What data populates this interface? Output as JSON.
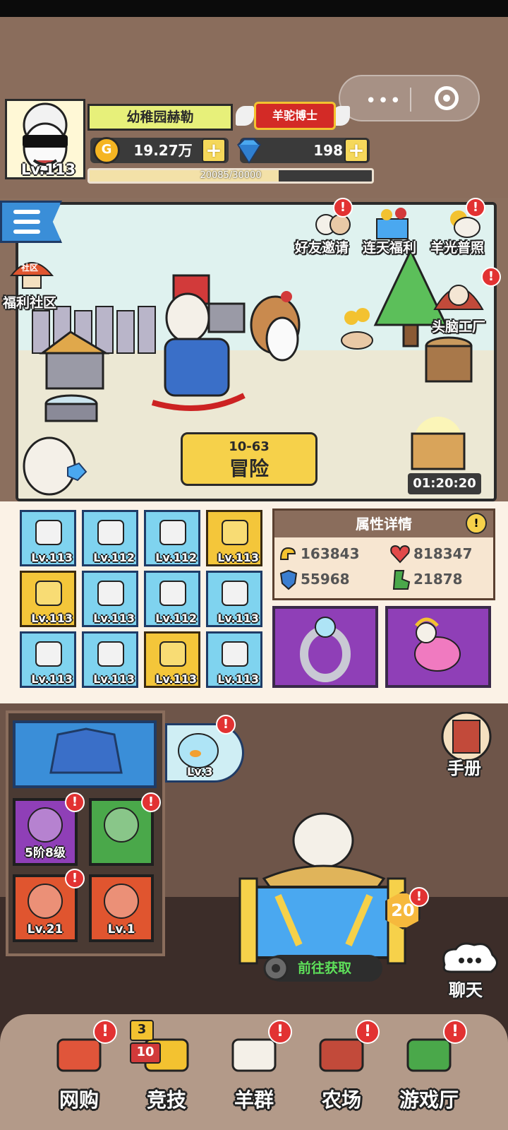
{
  "player": {
    "name": "幼稚园赫勒",
    "level": "Lv.113",
    "title": "羊驼博士",
    "gold": "19.27万",
    "gems": "198",
    "xp_text": "20085/30000",
    "xp_progress": 0.6695
  },
  "scene": {
    "events": [
      {
        "label": "好友邀请",
        "icon": "friends-icon",
        "alert": "!"
      },
      {
        "label": "连天福利",
        "icon": "gift-box-icon",
        "alert": ""
      },
      {
        "label": "羊光普照",
        "icon": "sunshine-sheep-icon",
        "alert": "!"
      }
    ],
    "community_label": "福利社区",
    "community_sign": "社区",
    "brain_factory_label": "头脑工厂",
    "brain_factory_alert": "!",
    "adventure_stage": "10-63",
    "adventure_label": "冒险",
    "chest_timer": "01:20:20"
  },
  "equipment": [
    {
      "level": "Lv.113",
      "icon": "sock-icon",
      "gold": false
    },
    {
      "level": "Lv.112",
      "icon": "razor-icon",
      "gold": false
    },
    {
      "level": "Lv.112",
      "icon": "hat-icon",
      "gold": false
    },
    {
      "level": "Lv.113",
      "icon": "basket-icon",
      "gold": true
    },
    {
      "level": "Lv.113",
      "icon": "trophy-icon",
      "gold": true
    },
    {
      "level": "Lv.113",
      "icon": "scroll-stand-icon",
      "gold": false
    },
    {
      "level": "Lv.112",
      "icon": "flower-bowl-icon",
      "gold": false
    },
    {
      "level": "Lv.113",
      "icon": "bonsai-icon",
      "gold": false
    },
    {
      "level": "Lv.113",
      "icon": "apple-icon",
      "gold": false
    },
    {
      "level": "Lv.113",
      "icon": "frame-icon",
      "gold": false
    },
    {
      "level": "Lv.113",
      "icon": "trident-icon",
      "gold": true
    },
    {
      "level": "Lv.113",
      "icon": "crown-stand-icon",
      "gold": false
    }
  ],
  "attributes": {
    "title": "属性详情",
    "info": "!",
    "attack": "163843",
    "health": "818347",
    "defense": "55968",
    "speed": "21878"
  },
  "slots": {
    "accessory": "ring-icon",
    "pet": "rainbow-llama-icon"
  },
  "items": {
    "outfit": "jacket-icon",
    "fishbowl_level": "Lv.3",
    "fishbowl_alert": "!",
    "list": [
      {
        "label": "5阶8级",
        "icon": "drop-icon",
        "alert": "!"
      },
      {
        "label": "",
        "icon": "rubiks-cube-icon",
        "alert": "!"
      },
      {
        "label": "Lv.21",
        "icon": "hedgehog-icon",
        "alert": "!"
      },
      {
        "label": "Lv.1",
        "icon": "battery-icon",
        "alert": ""
      }
    ]
  },
  "manual_label": "手册",
  "chat_label": "聊天",
  "pasture": {
    "level_badge": "20",
    "alert": "!",
    "go_button": "前往获取"
  },
  "nav": [
    {
      "label": "网购",
      "icon": "shopping-basket-icon",
      "alert": "!"
    },
    {
      "label": "竞技",
      "icon": "trophy-cup-icon",
      "alert": "",
      "badge_top": "3",
      "badge_bottom": "10"
    },
    {
      "label": "羊群",
      "icon": "sheep-flock-icon",
      "alert": "!"
    },
    {
      "label": "农场",
      "icon": "barn-icon",
      "alert": "!"
    },
    {
      "label": "游戏厅",
      "icon": "arcade-icon",
      "alert": "!"
    }
  ],
  "colors": {
    "background": "#8a6d5c",
    "gold": "#f6d14a",
    "blue": "#3a8ed8",
    "purple": "#8f3fb7",
    "alert": "#e23232"
  }
}
